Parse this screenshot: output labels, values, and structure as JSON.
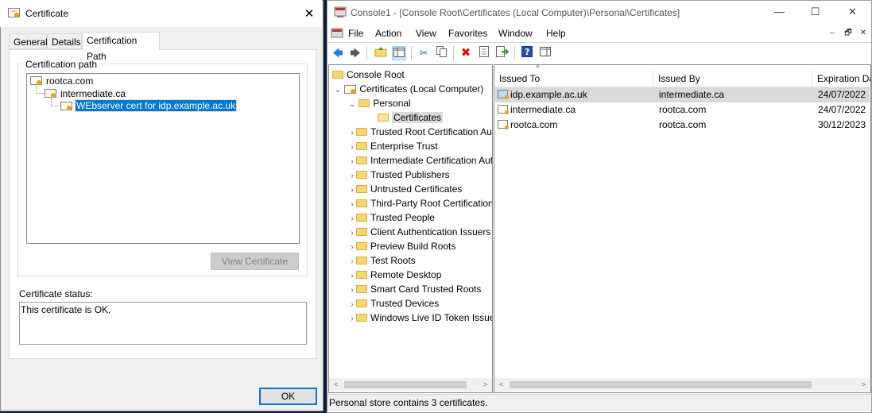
{
  "certificate_dialog": {
    "title": "Certificate",
    "tabs": [
      "General",
      "Details",
      "Certification Path"
    ],
    "path_group_label": "Certification path",
    "path": [
      {
        "label": "rootca.com"
      },
      {
        "label": "intermediate.ca"
      },
      {
        "label": "WEbserver cert for idp.example.ac.uk"
      }
    ],
    "view_certificate_label": "View Certificate",
    "status_label": "Certificate status:",
    "status_text": "This certificate is OK.",
    "ok_label": "OK",
    "close_glyph": "✕"
  },
  "mmc": {
    "title": "Console1 - [Console Root\\Certificates (Local Computer)\\Personal\\Certificates]",
    "window_buttons": {
      "minimize": "—",
      "maximize": "☐",
      "close": "✕"
    },
    "mdi_buttons": {
      "minimize": "–",
      "restore": "🗗",
      "close": "✕"
    },
    "menu": [
      "File",
      "Action",
      "View",
      "Favorites",
      "Window",
      "Help"
    ],
    "toolbar_icons": [
      "back-icon",
      "forward-icon",
      "up-folder-icon",
      "show-hide-tree-icon",
      "cut-icon",
      "copy-icon",
      "delete-icon",
      "properties-icon",
      "export-icon",
      "help-icon",
      "action-pane-icon"
    ],
    "tree": {
      "console_root": "Console Root",
      "certificates_local": "Certificates (Local Computer)",
      "personal": "Personal",
      "personal_certificates": "Certificates",
      "stores": [
        "Trusted Root Certification Authorities",
        "Enterprise Trust",
        "Intermediate Certification Authorities",
        "Trusted Publishers",
        "Untrusted Certificates",
        "Third-Party Root Certification Authorities",
        "Trusted People",
        "Client Authentication Issuers",
        "Preview Build Roots",
        "Test Roots",
        "Remote Desktop",
        "Smart Card Trusted Roots",
        "Trusted Devices",
        "Windows Live ID Token Issuer"
      ]
    },
    "list": {
      "columns": [
        "Issued To",
        "Issued By",
        "Expiration Date"
      ],
      "rows": [
        {
          "issued_to": "idp.example.ac.uk",
          "issued_by": "intermediate.ca",
          "expires": "24/07/2022"
        },
        {
          "issued_to": "intermediate.ca",
          "issued_by": "rootca.com",
          "expires": "24/07/2022"
        },
        {
          "issued_to": "rootca.com",
          "issued_by": "rootca.com",
          "expires": "30/12/2023"
        }
      ]
    },
    "status_bar": "Personal store contains 3 certificates."
  }
}
